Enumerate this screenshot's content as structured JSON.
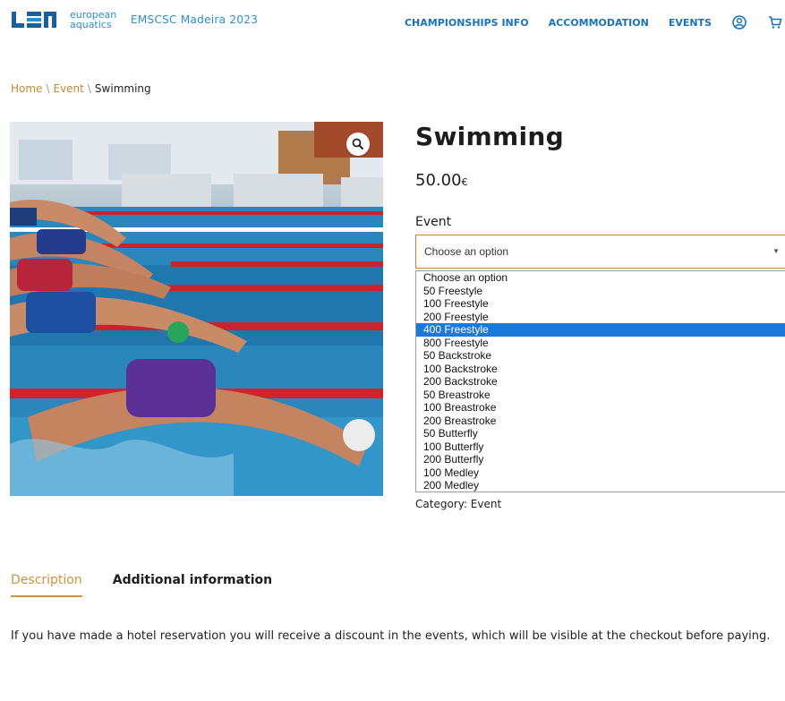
{
  "header": {
    "logo_line1": "european",
    "logo_line2": "aquatics",
    "site_name": "EMSCSC Madeira 2023",
    "nav": [
      "CHAMPIONSHIPS INFO",
      "ACCOMMODATION",
      "EVENTS"
    ],
    "icons": [
      "user-icon",
      "cart-icon"
    ]
  },
  "breadcrumb": {
    "home": "Home",
    "event": "Event",
    "current": "Swimming",
    "separator": "\\"
  },
  "product": {
    "title": "Swimming",
    "price": "50.00",
    "currency": "€",
    "field_label": "Event",
    "select_value": "Choose an option",
    "options": [
      "Choose an option",
      "50 Freestyle",
      "100 Freestyle",
      "200 Freestyle",
      "400 Freestyle",
      "800 Freestyle",
      "50 Backstroke",
      "100 Backstroke",
      "200 Backstroke",
      "50 Breastroke",
      "100 Breastroke",
      "200 Breastroke",
      "50 Butterfly",
      "100 Butterfly",
      "200 Butterfly",
      "100 Medley",
      "200 Medley"
    ],
    "highlighted_option": "400 Freestyle",
    "category": "Category: Event"
  },
  "tabs": {
    "description": "Description",
    "additional": "Additional information"
  },
  "description_text": "If you have made a hotel reservation you will receive a discount in the events, which will be visible at the checkout before paying.",
  "colors": {
    "accent": "#c9953f",
    "nav": "#1a73b8",
    "highlight": "#1e78d7"
  }
}
